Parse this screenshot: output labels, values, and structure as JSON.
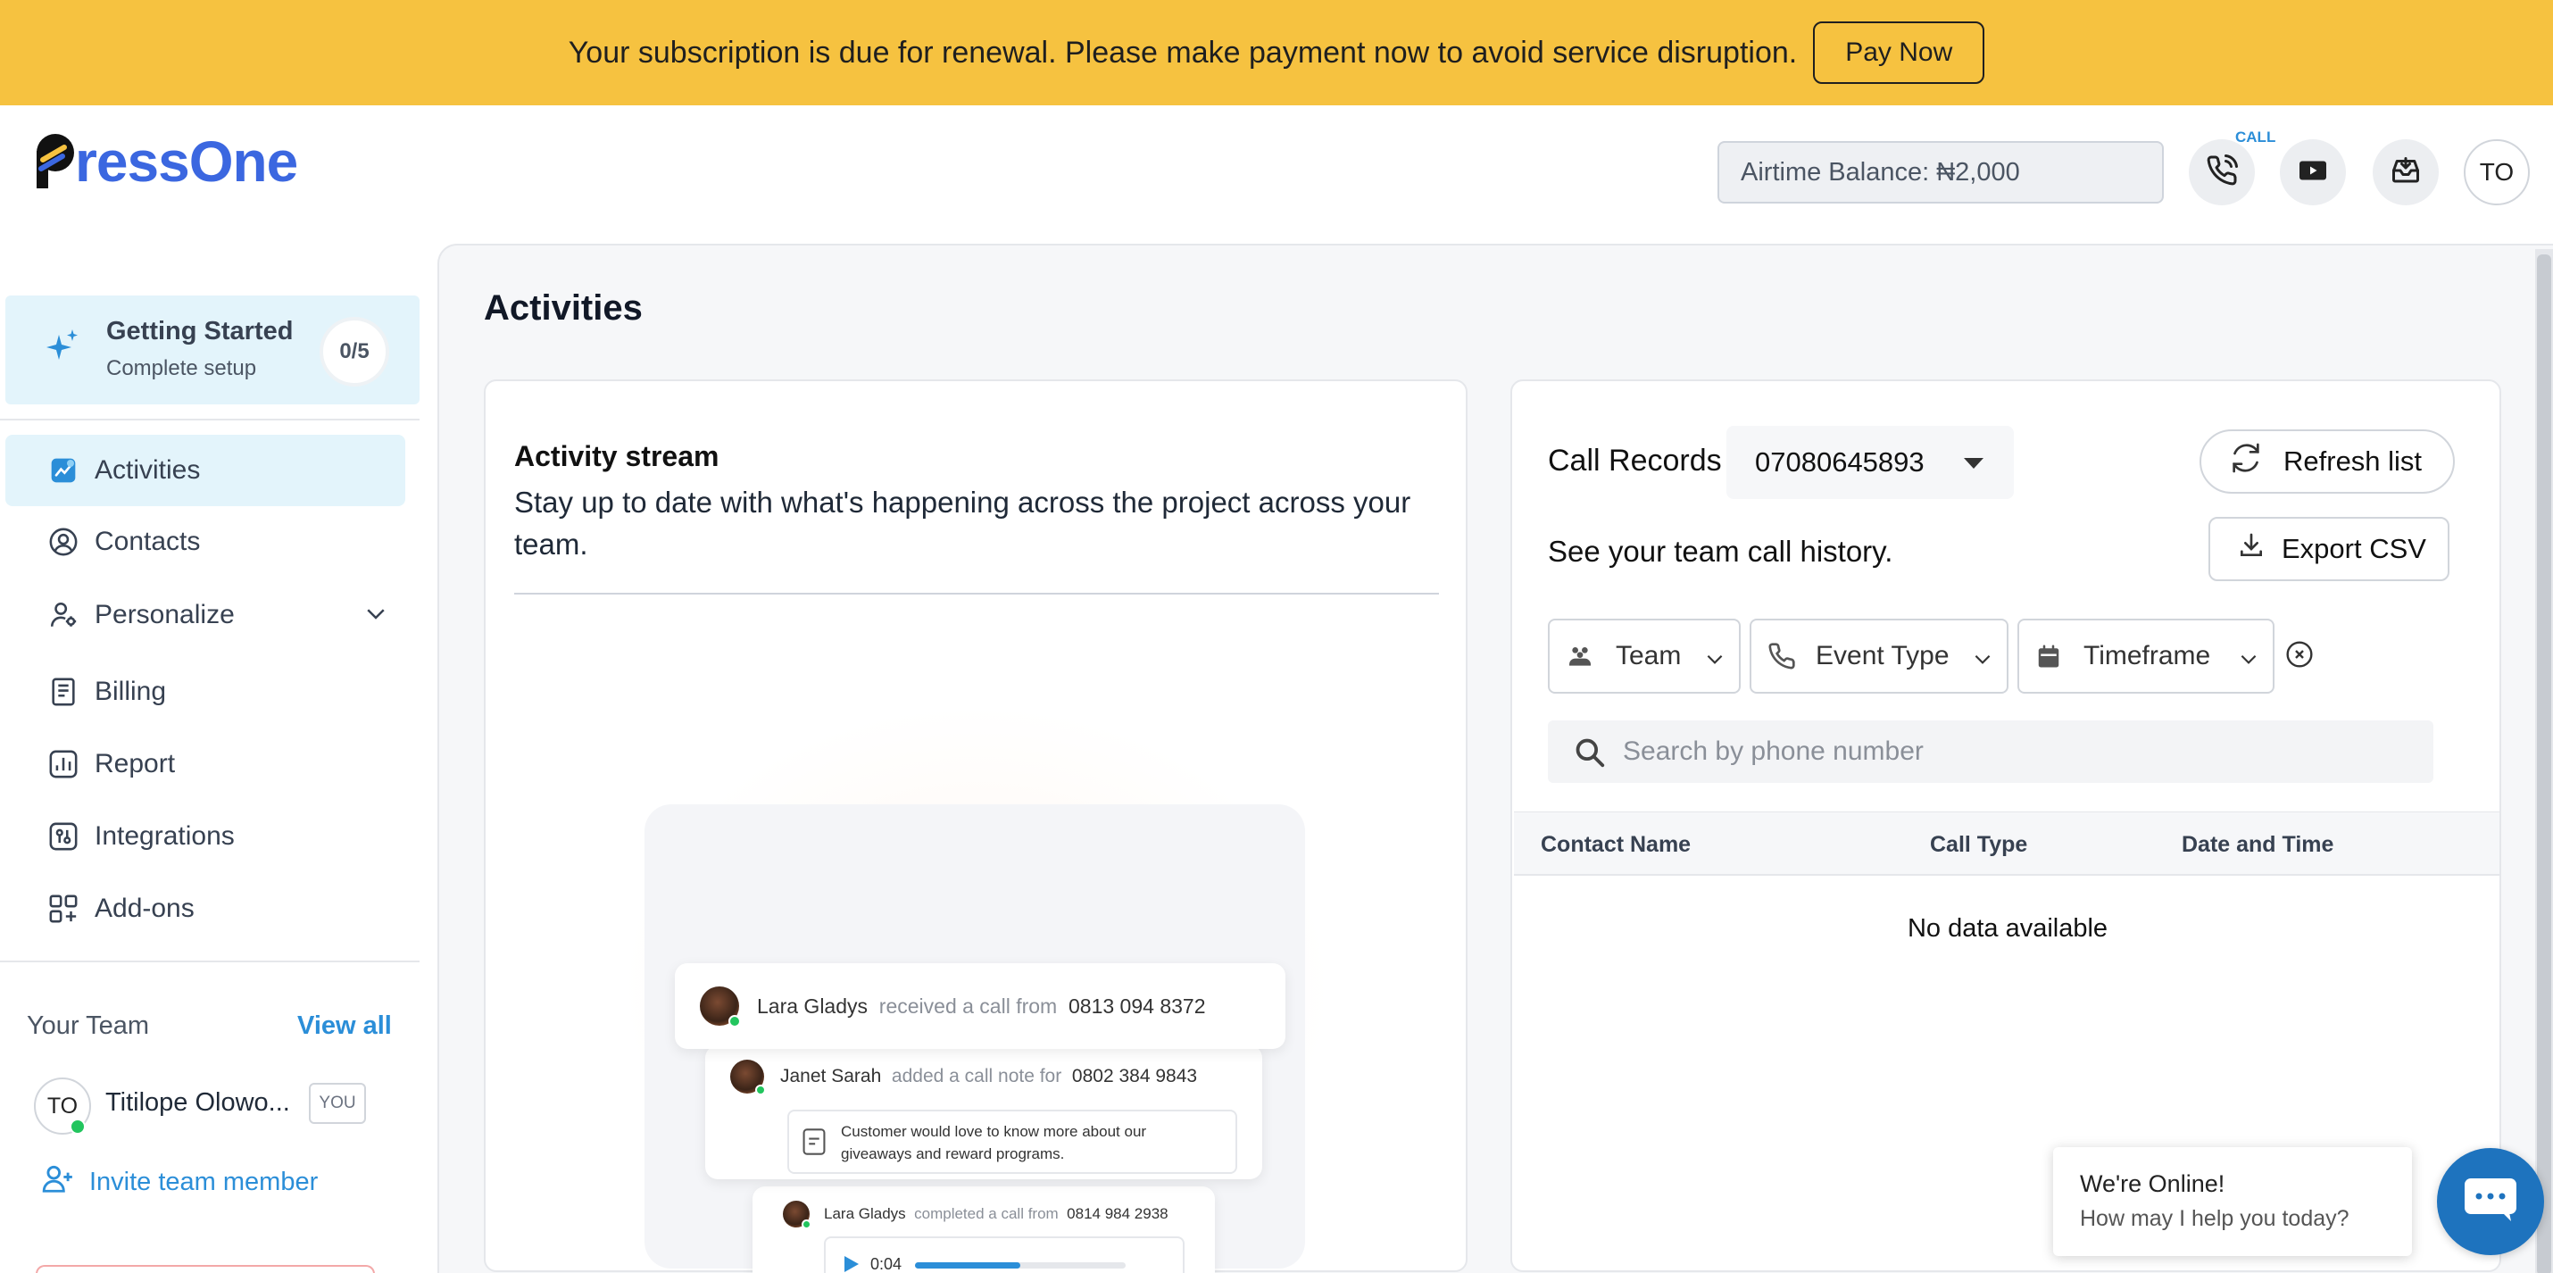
{
  "banner": {
    "message": "Your subscription is due for renewal. Please make payment now to avoid service disruption.",
    "pay_label": "Pay Now",
    "color": "#F6C240"
  },
  "header": {
    "logo_text": "ressOne",
    "airtime": "Airtime Balance: ₦2,000",
    "call_tag": "CALL",
    "avatar_initials": "TO",
    "icons": [
      "phone-icon",
      "video-play-icon",
      "inbox-download-icon"
    ]
  },
  "sidebar": {
    "getting_started": {
      "title": "Getting Started",
      "subtitle": "Complete setup",
      "progress": "0/5"
    },
    "items": [
      {
        "label": "Activities",
        "icon": "activity-chart-icon",
        "active": true
      },
      {
        "label": "Contacts",
        "icon": "user-circle-icon"
      },
      {
        "label": "Personalize",
        "icon": "user-settings-icon"
      },
      {
        "label": "Billing",
        "icon": "receipt-icon"
      },
      {
        "label": "Report",
        "icon": "bar-report-icon"
      },
      {
        "label": "Integrations",
        "icon": "integrations-icon"
      },
      {
        "label": "Add-ons",
        "icon": "add-ons-icon"
      }
    ],
    "team": {
      "title": "Your Team",
      "view_all": "View all",
      "member_initials": "TO",
      "member_name": "Titilope Olowo...",
      "member_badge": "YOU",
      "invite": "Invite team member"
    }
  },
  "main": {
    "title": "Activities",
    "stream": {
      "title": "Activity stream",
      "description": "Stay up to date with what's happening across the project across your team.",
      "illustration": {
        "row1": {
          "name": "Lara Gladys",
          "action": "received a call from",
          "number": "0813 094 8372"
        },
        "row2": {
          "name": "Janet Sarah",
          "action": "added a call note for",
          "number": "0802 384 9843",
          "note": "Customer would love to know more about our giveaways and reward programs."
        },
        "row3": {
          "name": "Lara Gladys",
          "action": "completed a call from",
          "number": "0814 984 2938",
          "audio_time": "0:04",
          "audio_progress": 0.5
        }
      }
    },
    "records": {
      "title": "Call Records",
      "number": "07080645893",
      "refresh": "Refresh list",
      "export": "Export CSV",
      "subtitle": "See your team call history.",
      "filters": {
        "team": "Team",
        "event": "Event Type",
        "timeframe": "Timeframe"
      },
      "search_placeholder": "Search by phone number",
      "columns": [
        "Contact Name",
        "Call Type",
        "Date and Time"
      ],
      "empty": "No data available"
    }
  },
  "chat": {
    "title": "We're Online!",
    "subtitle": "How may I help you today?",
    "color": "#1E73BE"
  }
}
